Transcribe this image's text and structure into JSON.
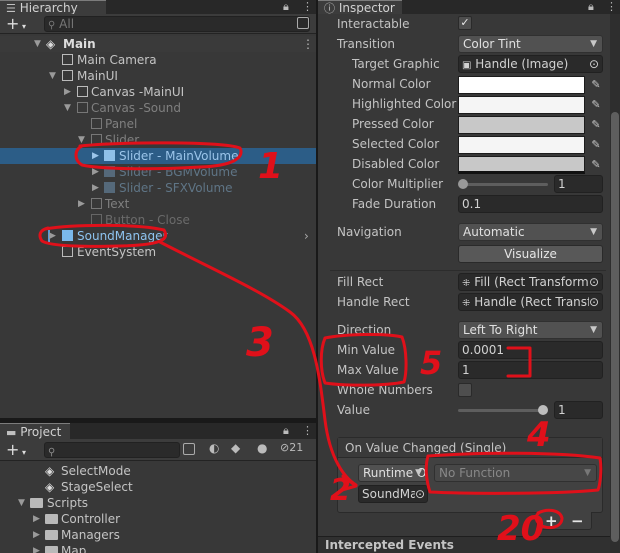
{
  "hierarchy": {
    "tab_label": "Hierarchy",
    "search_placeholder": "All",
    "add_label": "+",
    "items": [
      {
        "label": "Main",
        "indent": 1
      },
      {
        "label": "Main Camera",
        "indent": 2
      },
      {
        "label": "MainUI",
        "indent": 2
      },
      {
        "label": "Canvas -MainUI",
        "indent": 3
      },
      {
        "label": "Canvas -Sound",
        "indent": 3
      },
      {
        "label": "Panel",
        "indent": 4
      },
      {
        "label": "Slider",
        "indent": 4
      },
      {
        "label": "Slider - MainVolume",
        "indent": 5
      },
      {
        "label": "Slider - BGMVolume",
        "indent": 5
      },
      {
        "label": "Slider - SFXVolume",
        "indent": 5
      },
      {
        "label": "Text",
        "indent": 4
      },
      {
        "label": "Button - Close",
        "indent": 4
      },
      {
        "label": "SoundManager",
        "indent": 2
      },
      {
        "label": "EventSystem",
        "indent": 2
      }
    ]
  },
  "project": {
    "tab_label": "Project",
    "add_label": "+",
    "hidden_count": "21",
    "items": [
      "SelectMode",
      "StageSelect",
      "Scripts",
      "Controller",
      "Managers",
      "Map"
    ]
  },
  "inspector": {
    "tab_label": "Inspector",
    "interactable_label": "Interactable",
    "transition_label": "Transition",
    "transition_value": "Color Tint",
    "target_graphic_label": "Target Graphic",
    "target_graphic_value": "Handle (Image)",
    "normal_color_label": "Normal Color",
    "highlighted_color_label": "Highlighted Color",
    "pressed_color_label": "Pressed Color",
    "selected_color_label": "Selected Color",
    "disabled_color_label": "Disabled Color",
    "color_multiplier_label": "Color Multiplier",
    "color_multiplier_value": "1",
    "fade_duration_label": "Fade Duration",
    "fade_duration_value": "0.1",
    "navigation_label": "Navigation",
    "navigation_value": "Automatic",
    "visualize_label": "Visualize",
    "fill_rect_label": "Fill Rect",
    "fill_rect_value": "Fill (Rect Transform)",
    "handle_rect_label": "Handle Rect",
    "handle_rect_value": "Handle (Rect Transf",
    "direction_label": "Direction",
    "direction_value": "Left To Right",
    "min_value_label": "Min Value",
    "min_value": "0.0001",
    "max_value_label": "Max Value",
    "max_value": "1",
    "whole_numbers_label": "Whole Numbers",
    "value_label": "Value",
    "value": "1",
    "event_header": "On Value Changed (Single)",
    "runtime_label": "Runtime O",
    "function_value": "No Function",
    "object_value": "SoundMa",
    "add_button": "+",
    "remove_button": "−",
    "intercepted_label": "Intercepted Events"
  },
  "annotations": [
    "1",
    "2",
    "3",
    "4",
    "5",
    "20"
  ],
  "colors": {
    "annotation": "#e0101a",
    "selection": "#2c5d87",
    "prefab_blue": "#7ab9ec"
  }
}
